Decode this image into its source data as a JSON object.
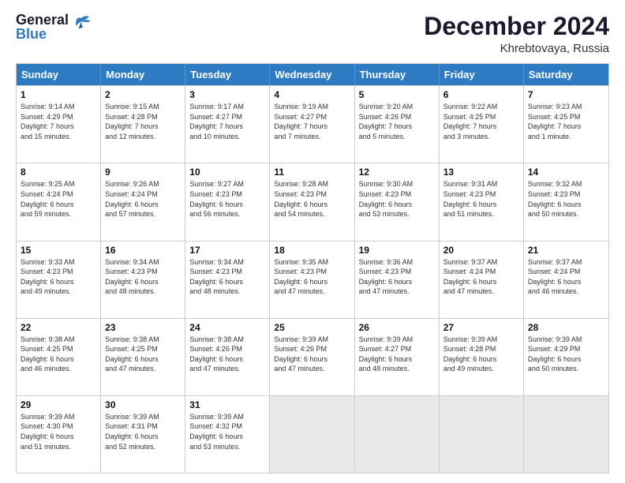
{
  "header": {
    "logo_general": "General",
    "logo_blue": "Blue",
    "month_title": "December 2024",
    "location": "Khrebtovaya, Russia"
  },
  "weekdays": [
    "Sunday",
    "Monday",
    "Tuesday",
    "Wednesday",
    "Thursday",
    "Friday",
    "Saturday"
  ],
  "weeks": [
    [
      {
        "day": "1",
        "lines": [
          "Sunrise: 9:14 AM",
          "Sunset: 4:29 PM",
          "Daylight: 7 hours",
          "and 15 minutes."
        ]
      },
      {
        "day": "2",
        "lines": [
          "Sunrise: 9:15 AM",
          "Sunset: 4:28 PM",
          "Daylight: 7 hours",
          "and 12 minutes."
        ]
      },
      {
        "day": "3",
        "lines": [
          "Sunrise: 9:17 AM",
          "Sunset: 4:27 PM",
          "Daylight: 7 hours",
          "and 10 minutes."
        ]
      },
      {
        "day": "4",
        "lines": [
          "Sunrise: 9:19 AM",
          "Sunset: 4:27 PM",
          "Daylight: 7 hours",
          "and 7 minutes."
        ]
      },
      {
        "day": "5",
        "lines": [
          "Sunrise: 9:20 AM",
          "Sunset: 4:26 PM",
          "Daylight: 7 hours",
          "and 5 minutes."
        ]
      },
      {
        "day": "6",
        "lines": [
          "Sunrise: 9:22 AM",
          "Sunset: 4:25 PM",
          "Daylight: 7 hours",
          "and 3 minutes."
        ]
      },
      {
        "day": "7",
        "lines": [
          "Sunrise: 9:23 AM",
          "Sunset: 4:25 PM",
          "Daylight: 7 hours",
          "and 1 minute."
        ]
      }
    ],
    [
      {
        "day": "8",
        "lines": [
          "Sunrise: 9:25 AM",
          "Sunset: 4:24 PM",
          "Daylight: 6 hours",
          "and 59 minutes."
        ]
      },
      {
        "day": "9",
        "lines": [
          "Sunrise: 9:26 AM",
          "Sunset: 4:24 PM",
          "Daylight: 6 hours",
          "and 57 minutes."
        ]
      },
      {
        "day": "10",
        "lines": [
          "Sunrise: 9:27 AM",
          "Sunset: 4:23 PM",
          "Daylight: 6 hours",
          "and 56 minutes."
        ]
      },
      {
        "day": "11",
        "lines": [
          "Sunrise: 9:28 AM",
          "Sunset: 4:23 PM",
          "Daylight: 6 hours",
          "and 54 minutes."
        ]
      },
      {
        "day": "12",
        "lines": [
          "Sunrise: 9:30 AM",
          "Sunset: 4:23 PM",
          "Daylight: 6 hours",
          "and 53 minutes."
        ]
      },
      {
        "day": "13",
        "lines": [
          "Sunrise: 9:31 AM",
          "Sunset: 4:23 PM",
          "Daylight: 6 hours",
          "and 51 minutes."
        ]
      },
      {
        "day": "14",
        "lines": [
          "Sunrise: 9:32 AM",
          "Sunset: 4:23 PM",
          "Daylight: 6 hours",
          "and 50 minutes."
        ]
      }
    ],
    [
      {
        "day": "15",
        "lines": [
          "Sunrise: 9:33 AM",
          "Sunset: 4:23 PM",
          "Daylight: 6 hours",
          "and 49 minutes."
        ]
      },
      {
        "day": "16",
        "lines": [
          "Sunrise: 9:34 AM",
          "Sunset: 4:23 PM",
          "Daylight: 6 hours",
          "and 48 minutes."
        ]
      },
      {
        "day": "17",
        "lines": [
          "Sunrise: 9:34 AM",
          "Sunset: 4:23 PM",
          "Daylight: 6 hours",
          "and 48 minutes."
        ]
      },
      {
        "day": "18",
        "lines": [
          "Sunrise: 9:35 AM",
          "Sunset: 4:23 PM",
          "Daylight: 6 hours",
          "and 47 minutes."
        ]
      },
      {
        "day": "19",
        "lines": [
          "Sunrise: 9:36 AM",
          "Sunset: 4:23 PM",
          "Daylight: 6 hours",
          "and 47 minutes."
        ]
      },
      {
        "day": "20",
        "lines": [
          "Sunrise: 9:37 AM",
          "Sunset: 4:24 PM",
          "Daylight: 6 hours",
          "and 47 minutes."
        ]
      },
      {
        "day": "21",
        "lines": [
          "Sunrise: 9:37 AM",
          "Sunset: 4:24 PM",
          "Daylight: 6 hours",
          "and 46 minutes."
        ]
      }
    ],
    [
      {
        "day": "22",
        "lines": [
          "Sunrise: 9:38 AM",
          "Sunset: 4:25 PM",
          "Daylight: 6 hours",
          "and 46 minutes."
        ]
      },
      {
        "day": "23",
        "lines": [
          "Sunrise: 9:38 AM",
          "Sunset: 4:25 PM",
          "Daylight: 6 hours",
          "and 47 minutes."
        ]
      },
      {
        "day": "24",
        "lines": [
          "Sunrise: 9:38 AM",
          "Sunset: 4:26 PM",
          "Daylight: 6 hours",
          "and 47 minutes."
        ]
      },
      {
        "day": "25",
        "lines": [
          "Sunrise: 9:39 AM",
          "Sunset: 4:26 PM",
          "Daylight: 6 hours",
          "and 47 minutes."
        ]
      },
      {
        "day": "26",
        "lines": [
          "Sunrise: 9:39 AM",
          "Sunset: 4:27 PM",
          "Daylight: 6 hours",
          "and 48 minutes."
        ]
      },
      {
        "day": "27",
        "lines": [
          "Sunrise: 9:39 AM",
          "Sunset: 4:28 PM",
          "Daylight: 6 hours",
          "and 49 minutes."
        ]
      },
      {
        "day": "28",
        "lines": [
          "Sunrise: 9:39 AM",
          "Sunset: 4:29 PM",
          "Daylight: 6 hours",
          "and 50 minutes."
        ]
      }
    ],
    [
      {
        "day": "29",
        "lines": [
          "Sunrise: 9:39 AM",
          "Sunset: 4:30 PM",
          "Daylight: 6 hours",
          "and 51 minutes."
        ]
      },
      {
        "day": "30",
        "lines": [
          "Sunrise: 9:39 AM",
          "Sunset: 4:31 PM",
          "Daylight: 6 hours",
          "and 52 minutes."
        ]
      },
      {
        "day": "31",
        "lines": [
          "Sunrise: 9:39 AM",
          "Sunset: 4:32 PM",
          "Daylight: 6 hours",
          "and 53 minutes."
        ]
      },
      {
        "day": "",
        "lines": []
      },
      {
        "day": "",
        "lines": []
      },
      {
        "day": "",
        "lines": []
      },
      {
        "day": "",
        "lines": []
      }
    ]
  ]
}
